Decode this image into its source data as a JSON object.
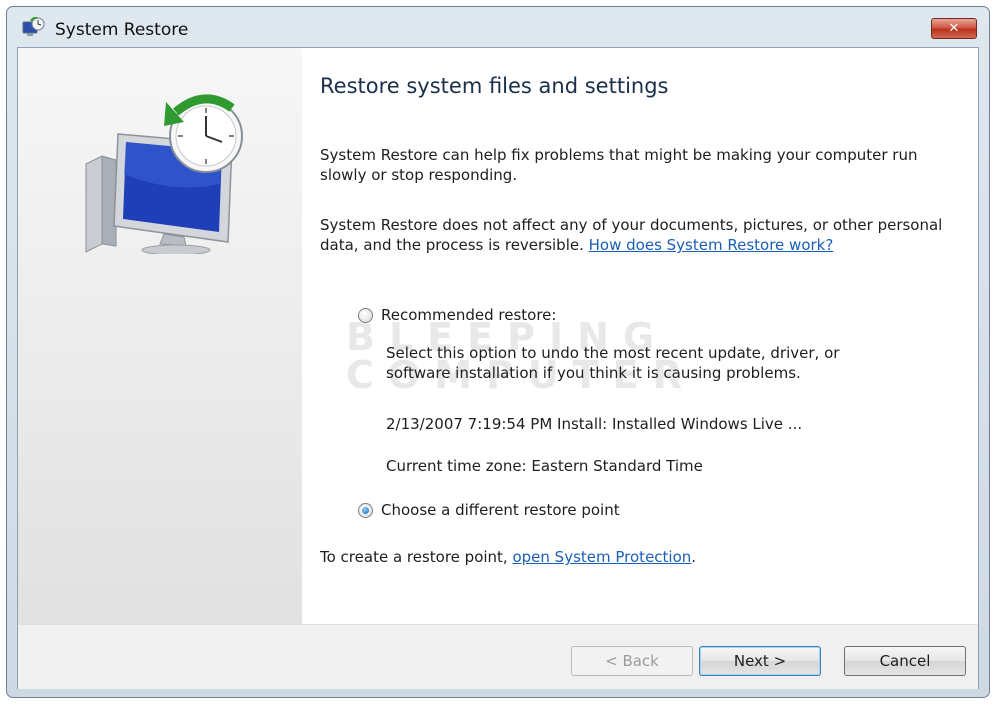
{
  "window": {
    "title": "System Restore",
    "close_label": "✕",
    "icon": "system-restore-icon"
  },
  "left_panel": {
    "icon": "monitor-clock-restore-icon"
  },
  "main": {
    "heading": "Restore system files and settings",
    "intro": "System Restore can help fix problems that might be making your computer run slowly or stop responding.",
    "info_text": "System Restore does not affect any of your documents, pictures, or other personal data, and the process is reversible.",
    "info_link": "How does System Restore work?",
    "watermark": "BLEEPING COMPUTER",
    "options": [
      {
        "label": "Recommended restore:",
        "selected": false,
        "description": "Select this option to undo the most recent update, driver, or software installation if you think it is causing problems.",
        "restore_point": "2/13/2007 7:19:54 PM Install: Installed Windows Live ...",
        "time_zone": "Current time zone: Eastern Standard Time"
      },
      {
        "label": "Choose a different restore point",
        "selected": true
      }
    ],
    "protection_prefix": "To create a restore point,",
    "protection_link": "open System Protection",
    "protection_suffix": "."
  },
  "footer": {
    "back_label": "< Back",
    "next_label": "Next >",
    "cancel_label": "Cancel"
  },
  "colors": {
    "link": "#1a5fb4",
    "heading": "#1b2f4a",
    "close_button": "#c8452f"
  }
}
